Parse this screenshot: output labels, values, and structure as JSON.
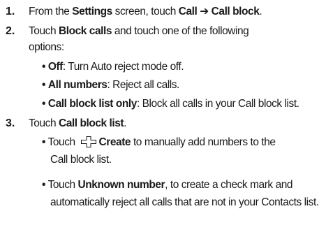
{
  "steps": {
    "s1": {
      "number": "1.",
      "a": "From the ",
      "b_settings": "Settings",
      "c": " screen, touch ",
      "b_call": "Call",
      "arrow": " ➔ ",
      "b_call_block": "Call block",
      "d": "."
    },
    "s2": {
      "number": "2.",
      "a": "Touch ",
      "b_block_calls": "Block calls",
      "c": " and touch one of the following",
      "line2": "options:",
      "bullets": [
        {
          "label": "Off",
          "text": ": Turn Auto reject mode off."
        },
        {
          "label": "All numbers",
          "text": ": Reject all calls."
        },
        {
          "label": "Call block list only",
          "text": ": Block all calls in your Call block list."
        }
      ]
    },
    "s3": {
      "number": "3.",
      "a": "Touch ",
      "b_call_block_list": "Call block list",
      "c": ".",
      "b1": {
        "a": "Touch ",
        "icon": "add-icon",
        "label": "Create",
        "b": " to manually add numbers to the",
        "line2": "Call block list."
      },
      "b2": {
        "a": "Touch ",
        "label": "Unknown number",
        "b": ", to create a check mark and",
        "line2": "automatically reject all calls that are not in your Contacts list."
      }
    }
  },
  "bullet_char": "•"
}
